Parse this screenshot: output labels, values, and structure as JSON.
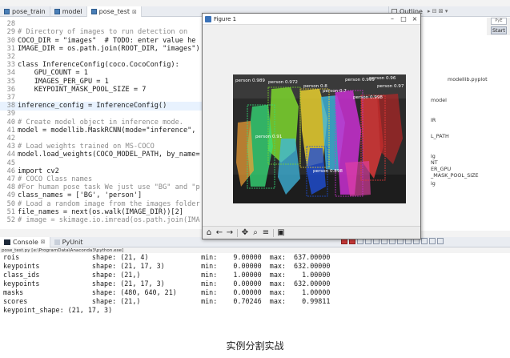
{
  "editor": {
    "tabs": [
      {
        "label": "pose_train",
        "active": false
      },
      {
        "label": "model",
        "active": false
      },
      {
        "label": "pose_test",
        "active": true
      }
    ],
    "lines": [
      {
        "num": "",
        "text": "",
        "style": "tx"
      },
      {
        "num": "28",
        "text": "",
        "style": "tx"
      },
      {
        "num": "29",
        "text": "# Directory of images to run detection on",
        "style": "tx comment"
      },
      {
        "num": "30",
        "text": "COCO_DIR = \"images\"  # TODO: enter value he",
        "style": "tx"
      },
      {
        "num": "31",
        "text": "IMAGE_DIR = os.path.join(ROOT_DIR, \"images\")",
        "style": "tx"
      },
      {
        "num": "32",
        "text": "",
        "style": "tx"
      },
      {
        "num": "33",
        "text": "class InferenceConfig(coco.CocoConfig):",
        "style": "tx kw"
      },
      {
        "num": "34",
        "text": "    GPU_COUNT = 1",
        "style": "tx"
      },
      {
        "num": "35",
        "text": "    IMAGES_PER_GPU = 1",
        "style": "tx"
      },
      {
        "num": "36",
        "text": "    KEYPOINT_MASK_POOL_SIZE = 7",
        "style": "tx"
      },
      {
        "num": "37",
        "text": "",
        "style": "tx"
      },
      {
        "num": "38",
        "text": "inference_config = InferenceConfig()",
        "style": "tx"
      },
      {
        "num": "39",
        "text": "",
        "style": "tx"
      },
      {
        "num": "40",
        "text": "# Create model object in inference mode.",
        "style": "tx comment"
      },
      {
        "num": "41",
        "text": "model = modellib.MaskRCNN(mode=\"inference\",",
        "style": "tx"
      },
      {
        "num": "42",
        "text": "",
        "style": "tx"
      },
      {
        "num": "43",
        "text": "# Load weights trained on MS-COCO",
        "style": "tx comment"
      },
      {
        "num": "44",
        "text": "model.load_weights(COCO_MODEL_PATH, by_name=",
        "style": "tx"
      },
      {
        "num": "45",
        "text": "",
        "style": "tx"
      },
      {
        "num": "46",
        "text": "import cv2",
        "style": "tx kw"
      },
      {
        "num": "47",
        "text": "# COCO Class names",
        "style": "tx comment"
      },
      {
        "num": "48",
        "text": "#For human pose task We just use \"BG\" and \"p",
        "style": "tx comment"
      },
      {
        "num": "49",
        "text": "class_names = ['BG', 'person']",
        "style": "tx"
      },
      {
        "num": "50",
        "text": "# Load a random image from the images folder",
        "style": "tx comment"
      },
      {
        "num": "51",
        "text": "file_names = next(os.walk(IMAGE_DIR))[2]",
        "style": "tx"
      },
      {
        "num": "52",
        "text": "# image = skimage.io.imread(os.path.join(IMA",
        "style": "tx comment"
      }
    ]
  },
  "outline": {
    "title": "Outline",
    "items": [
      "modellib.pyplot",
      "model",
      "IR",
      "L_PATH",
      "ig",
      "NT",
      "ER_GPU",
      "_MASK_POOL_SIZE",
      "ig"
    ]
  },
  "toolbar_right": {
    "perspective_label": "Start",
    "chip_label": "PyE"
  },
  "figure": {
    "title": "Figure 1",
    "controls": [
      "–",
      "□",
      "×"
    ],
    "toolbar": [
      "home-icon",
      "back-arrow-icon",
      "forward-arrow-icon",
      "pan-icon",
      "zoom-icon",
      "configure-icon",
      "save-icon"
    ],
    "detections": [
      {
        "label": "person 0.989",
        "color": "#7cd62e"
      },
      {
        "label": "person 0.972",
        "color": "#e8cf2f"
      },
      {
        "label": "person 0.8",
        "color": "#3fb8e0"
      },
      {
        "label": "person 0.7",
        "color": "#1f4fd6"
      },
      {
        "label": "person 0.999",
        "color": "#c92fd1"
      },
      {
        "label": "person 0.96",
        "color": "#f03a3a"
      },
      {
        "label": "person 0.97",
        "color": "#36e07a"
      },
      {
        "label": "person 0.998",
        "color": "#f2a134"
      },
      {
        "label": "person 0.91",
        "color": "#b32626"
      },
      {
        "label": "person 0.898",
        "color": "#e23fa3"
      }
    ]
  },
  "console": {
    "tabs": [
      {
        "label": "Console",
        "active": true
      },
      {
        "label": "PyUnit",
        "active": false
      }
    ],
    "path": "pose_test.py [e:\\ProgramData\\Anaconda3\\python.exe]",
    "lines": [
      "rois                  shape: (21, 4)             min:    9.00000  max:  637.00000",
      "keypoints             shape: (21, 17, 3)         min:    0.00000  max:  632.00000",
      "class_ids             shape: (21,)               min:    1.00000  max:    1.00000",
      "keypoints             shape: (21, 17, 3)         min:    0.00000  max:  632.00000",
      "masks                 shape: (480, 640, 21)      min:    0.00000  max:    1.00000",
      "scores                shape: (21,)               min:    0.70246  max:    0.99811",
      "keypoint_shape: (21, 17, 3)"
    ]
  },
  "caption": "实例分割实战"
}
